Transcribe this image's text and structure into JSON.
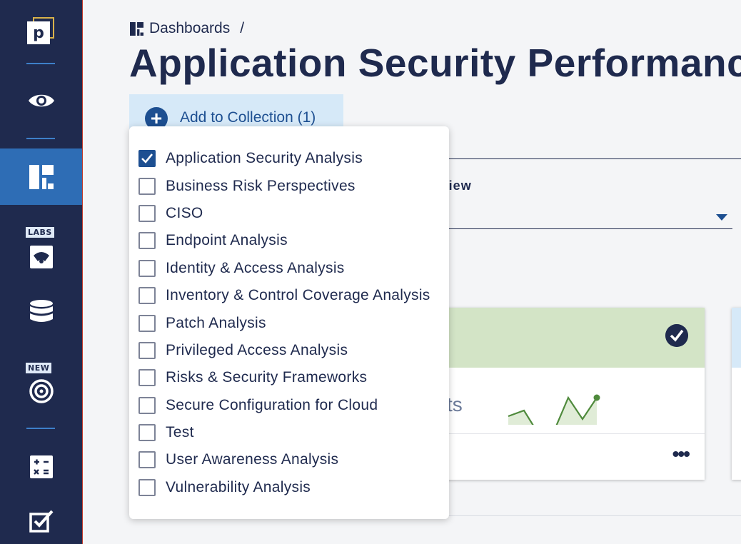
{
  "sidebar": {
    "logo_letter": "p",
    "labs_badge": "LABS",
    "new_badge": "NEW"
  },
  "breadcrumb": {
    "root": "Dashboards",
    "separator": "/"
  },
  "page": {
    "title": "Application Security Performance"
  },
  "add_button": {
    "label": "Add to Collection (1)",
    "icon": "plus-circle-icon"
  },
  "view_select": {
    "label_fragment": "View"
  },
  "card": {
    "partial_text": "ts",
    "menu_glyph": "•••",
    "status": "check-circle-icon"
  },
  "collections_dropdown": {
    "options": [
      {
        "label": "Application Security Analysis",
        "checked": true
      },
      {
        "label": "Business Risk Perspectives",
        "checked": false
      },
      {
        "label": "CISO",
        "checked": false
      },
      {
        "label": "Endpoint Analysis",
        "checked": false
      },
      {
        "label": "Identity & Access Analysis",
        "checked": false
      },
      {
        "label": "Inventory & Control Coverage Analysis",
        "checked": false
      },
      {
        "label": "Patch Analysis",
        "checked": false
      },
      {
        "label": "Privileged Access Analysis",
        "checked": false
      },
      {
        "label": "Risks & Security Frameworks",
        "checked": false
      },
      {
        "label": "Secure Configuration for Cloud",
        "checked": false
      },
      {
        "label": "Test",
        "checked": false
      },
      {
        "label": "User Awareness Analysis",
        "checked": false
      },
      {
        "label": "Vulnerability Analysis",
        "checked": false
      }
    ]
  },
  "colors": {
    "sidebar_bg": "#1f2a4e",
    "active_bg": "#2e6db5",
    "accent": "#1d4f91",
    "card_head": "#d3e4c6",
    "sparkline": "#4f8a3c"
  }
}
